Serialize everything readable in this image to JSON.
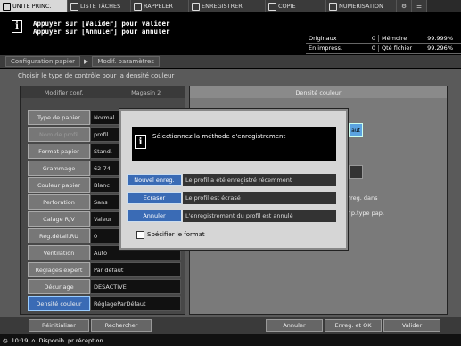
{
  "top_tabs": [
    {
      "label": "UNITE PRINC.",
      "icon": "printer-icon",
      "active": true
    },
    {
      "label": "LISTE TÂCHES",
      "icon": "list-icon",
      "active": false
    },
    {
      "label": "RAPPELER",
      "icon": "recall-icon",
      "active": false
    },
    {
      "label": "ENREGISTRER",
      "icon": "save-icon",
      "active": false
    },
    {
      "label": "COPIE",
      "icon": "copy-icon",
      "active": false
    },
    {
      "label": "NUMERISATION",
      "icon": "scan-icon",
      "active": false
    }
  ],
  "message": {
    "line1": "Appuyer sur [Valider] pour valider",
    "line2": "Appuyer sur [Annuler] pour annuler"
  },
  "counters": {
    "row1": {
      "label": "Originaux",
      "value": "0",
      "label2": "Mémoire",
      "value2": "99.999%"
    },
    "row2": {
      "label": "En impress.",
      "value": "0",
      "label2": "Qté fichier",
      "value2": "99.296%"
    }
  },
  "breadcrumb": {
    "item1": "Configuration papier",
    "item2": "Modif. paramètres"
  },
  "instruction": "Choisir le type de contrôle pour la densité couleur",
  "left_header": {
    "col1": "Modifier conf.",
    "col2": "Magasin 2"
  },
  "right_header": "Densité couleur",
  "params": [
    {
      "label": "Type de papier",
      "value": "Normal"
    },
    {
      "label": "Nom de profil",
      "value": "profil"
    },
    {
      "label": "Format papier",
      "value": "Stand."
    },
    {
      "label": "Grammage",
      "value": "62-74"
    },
    {
      "label": "Couleur papier",
      "value": "Blanc"
    },
    {
      "label": "Perforation",
      "value": "Sans"
    },
    {
      "label": "Calage R/V",
      "value": "Valeur"
    },
    {
      "label": "Rég.détail.RU",
      "value": "0"
    },
    {
      "label": "Ventilation",
      "value": "Auto"
    },
    {
      "label": "Réglages expert",
      "value": "Par défaut"
    },
    {
      "label": "Décurlage",
      "value": "DESACTIVE"
    },
    {
      "label": "Densité couleur",
      "value": "RéglageParDéfaut"
    }
  ],
  "right_fragments": {
    "btn1": "aut",
    "note1": "nreg. dans",
    "note2": "our p.type pap."
  },
  "bottom_buttons": {
    "reset": "Réinitialiser",
    "search": "Rechercher",
    "cancel": "Annuler",
    "save_ok": "Enreg. et OK",
    "validate": "Valider"
  },
  "status": {
    "time": "10:19",
    "text": "Disponib. pr réception"
  },
  "dialog": {
    "message": "Sélectionnez la méthode d'enregistrement",
    "options": [
      {
        "button": "Nouvel enreg.",
        "description": "Le profil a été enregistré récemment"
      },
      {
        "button": "Ecraser",
        "description": "Le profil est écrasé"
      },
      {
        "button": "Annuler",
        "description": "L'enregistrement du profil est annulé"
      }
    ],
    "checkbox_label": "Spécifier le format"
  }
}
